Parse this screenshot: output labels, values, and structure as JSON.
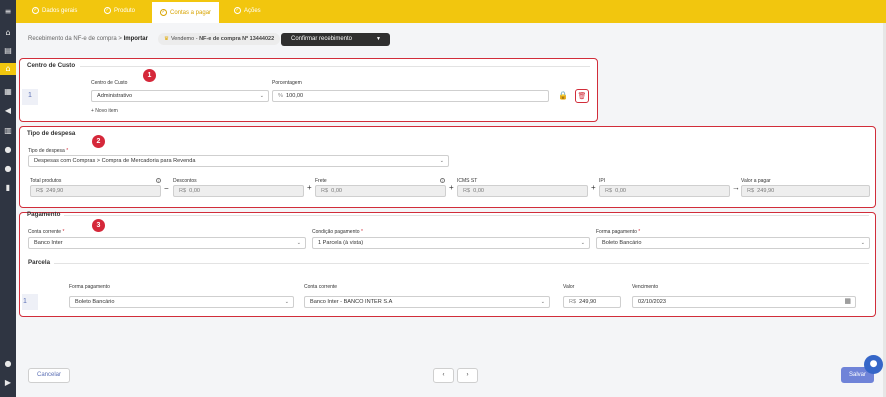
{
  "sidebar": {
    "items": [
      {
        "icon": "menu-icon",
        "glyph": "≡"
      },
      {
        "icon": "home-icon",
        "glyph": "⌂"
      },
      {
        "icon": "document-icon",
        "glyph": "▤"
      },
      {
        "icon": "store-icon",
        "glyph": "⌂"
      },
      {
        "icon": "building-icon",
        "glyph": "▦"
      },
      {
        "icon": "megaphone-icon",
        "glyph": "◀"
      },
      {
        "icon": "chart-icon",
        "glyph": "▥"
      },
      {
        "icon": "dollar-icon",
        "glyph": "●"
      },
      {
        "icon": "user-icon",
        "glyph": "●"
      },
      {
        "icon": "file-icon",
        "glyph": "▮"
      },
      {
        "icon": "user-settings-icon",
        "glyph": "●"
      },
      {
        "icon": "logout-icon",
        "glyph": "▶"
      }
    ]
  },
  "tabs": [
    {
      "label": "Dados gerais",
      "check": "✓"
    },
    {
      "label": "Produto",
      "check": "✓"
    },
    {
      "label": "Contas a pagar",
      "check": "✓"
    },
    {
      "label": "Ações",
      "check": "✓"
    }
  ],
  "breadcrumb": {
    "parent": "Recebimento da NF-e de compra",
    "sep": ">",
    "current": "Importar"
  },
  "vendor": {
    "icon": "♛",
    "prefix": "Vendemo - ",
    "label": "NF-e de compra Nº 13444022"
  },
  "confirm_button": {
    "label": "Confirmar recebimento",
    "caret": "▼"
  },
  "steps": [
    "1",
    "2",
    "3"
  ],
  "centro_custo": {
    "title": "Centro de Custo",
    "row_index": "1",
    "centro_label": "Centro de Custo",
    "centro_value": "Administrativo",
    "pct_label": "Porcentagem",
    "pct_prefix": "%",
    "pct_value": "100,00",
    "new_item": "+ Novo item",
    "lock_glyph": "🔒",
    "delete_glyph": "🗑"
  },
  "tipo_despesa": {
    "title": "Tipo de despesa",
    "field_label": "Tipo de despesa",
    "required": "*",
    "value": "Despesas com Compras > Compra de Mercadoria para Revenda",
    "totals": [
      {
        "label": "Total produtos",
        "currency": "R$",
        "value": "249,90",
        "info": "i"
      },
      {
        "label": "Descontos",
        "currency": "R$",
        "value": "0,00"
      },
      {
        "label": "Frete",
        "currency": "R$",
        "value": "0,00",
        "info": "i"
      },
      {
        "label": "ICMS ST",
        "currency": "R$",
        "value": "0,00"
      },
      {
        "label": "IPI",
        "currency": "R$",
        "value": "0,00"
      },
      {
        "label": "Valor a pagar",
        "currency": "R$",
        "value": "249,90"
      }
    ],
    "operators": [
      "−",
      "+",
      "+",
      "+",
      "→"
    ]
  },
  "pagamento": {
    "title": "Pagamento",
    "conta_label": "Conta corrente",
    "conta_value": "Banco Inter",
    "condicao_label": "Condição pagamento",
    "condicao_value": "1 Parcela (à vista)",
    "forma_label": "Forma pagamento",
    "forma_value": "Boleto Bancário",
    "required": "*",
    "parcela_title": "Parcela",
    "parcela": {
      "index": "1",
      "forma_label": "Forma pagamento",
      "forma_value": "Boleto Bancário",
      "conta_label": "Conta corrente",
      "conta_value": "Banco Inter - BANCO INTER S.A",
      "valor_label": "Valor",
      "valor_currency": "R$",
      "valor_value": "249,90",
      "venc_label": "Vencimento",
      "venc_value": "02/10/2023",
      "calendar_glyph": "▦"
    }
  },
  "footer": {
    "cancel": "Cancelar",
    "prev": "‹",
    "next": "›",
    "save": "Salvar",
    "chat_glyph": "●"
  },
  "colors": {
    "accent": "#f2c60e",
    "sidebar": "#2f3542",
    "highlight": "#d12d3a",
    "primary": "#6f83d8"
  }
}
